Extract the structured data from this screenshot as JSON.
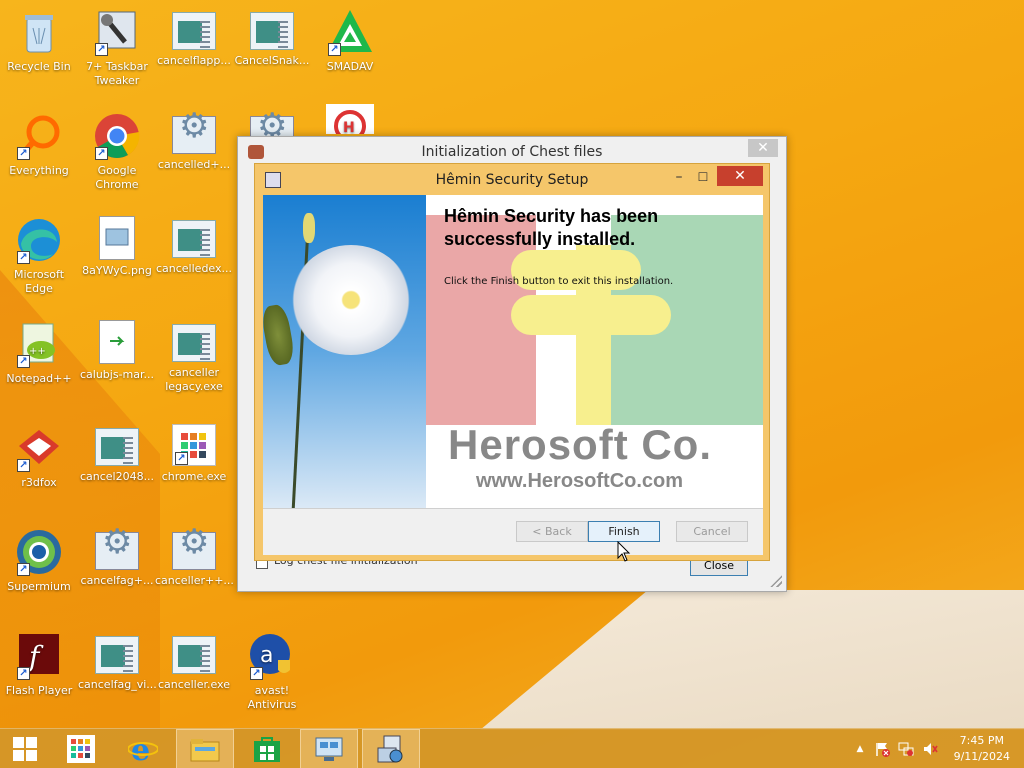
{
  "desktop": {
    "icons": [
      {
        "label": "Recycle Bin",
        "icon": "recycle-bin-icon"
      },
      {
        "label": "7+ Taskbar Tweaker",
        "icon": "taskbar-tweaker-icon"
      },
      {
        "label": "cancelflapp...",
        "icon": "window-icon"
      },
      {
        "label": "CancelSnak...",
        "icon": "window-icon"
      },
      {
        "label": "SMADAV",
        "icon": "smadav-icon"
      },
      {
        "label": "Everything",
        "icon": "everything-icon"
      },
      {
        "label": "Google Chrome",
        "icon": "chrome-icon"
      },
      {
        "label": "cancelled+...",
        "icon": "gear-window-icon"
      },
      {
        "label": "Microsoft Edge",
        "icon": "edge-icon"
      },
      {
        "label": "8aYWyC.png",
        "icon": "image-file-icon"
      },
      {
        "label": "cancelledex...",
        "icon": "window-icon"
      },
      {
        "label": "Notepad++",
        "icon": "notepad-plus-plus-icon"
      },
      {
        "label": "calubjs-mar...",
        "icon": "script-file-icon"
      },
      {
        "label": "canceller legacy.exe",
        "icon": "window-icon"
      },
      {
        "label": "r3dfox",
        "icon": "r3dfox-icon"
      },
      {
        "label": "cancel2048...",
        "icon": "window-icon"
      },
      {
        "label": "chrome.exe",
        "icon": "chrome-exe-icon"
      },
      {
        "label": "Supermium",
        "icon": "supermium-icon"
      },
      {
        "label": "cancelfag+...",
        "icon": "gear-window-icon"
      },
      {
        "label": "canceller++...",
        "icon": "gear-window-icon"
      },
      {
        "label": "Flash Player",
        "icon": "flash-player-icon"
      },
      {
        "label": "cancelfag_vi...",
        "icon": "window-icon"
      },
      {
        "label": "canceller.exe",
        "icon": "window-icon"
      },
      {
        "label": "avast! Antivirus",
        "icon": "avast-icon"
      }
    ]
  },
  "outer_window": {
    "title": "Initialization of Chest files",
    "close_glyph": "✕",
    "checkbox_label": "Log chest file initialization",
    "close_button": "Close"
  },
  "setup_window": {
    "title": "Hêmin Security Setup",
    "minimize_glyph": "–",
    "maximize_glyph": "☐",
    "close_glyph": "✕",
    "headline": "Hêmin Security has been successfully installed.",
    "instruction": "Click the Finish button to exit this installation.",
    "brand_name": "Herosoft Co.",
    "brand_url": "www.HerosoftCo.com",
    "buttons": {
      "back": "< Back",
      "finish": "Finish",
      "cancel": "Cancel"
    }
  },
  "taskbar": {
    "items": [
      "start-button",
      "apps-icon",
      "internet-explorer-icon",
      "file-explorer-icon",
      "store-icon",
      "remote-desktop-icon",
      "setup-installer-icon"
    ],
    "clock_time": "7:45 PM",
    "clock_date": "9/11/2024",
    "tray_expand_glyph": "▲"
  }
}
